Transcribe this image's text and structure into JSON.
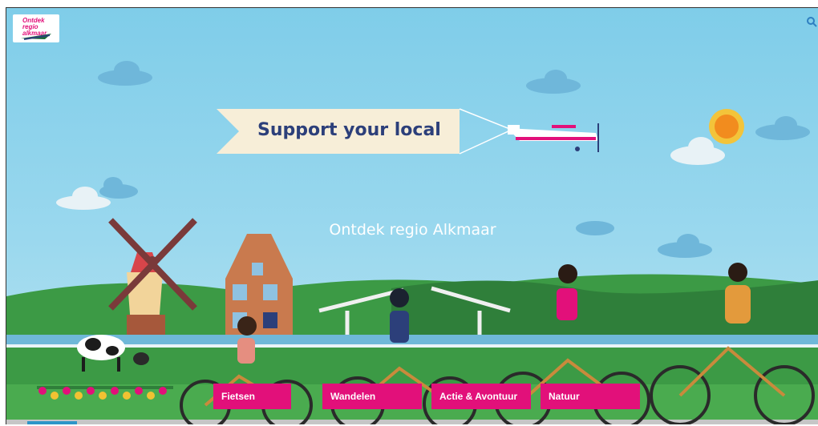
{
  "site": {
    "logo_text": "Ontdek regio alkmaar"
  },
  "hero": {
    "banner_text": "Support your local",
    "headline": "Ontdek regio Alkmaar"
  },
  "categories": [
    {
      "label": "Fietsen"
    },
    {
      "label": "Wandelen"
    },
    {
      "label": "Actie & Avontuur"
    },
    {
      "label": "Natuur"
    }
  ],
  "colors": {
    "accent": "#e2107a",
    "sky": "#8fd3ec",
    "heading": "#2c3f7a"
  },
  "icons": [
    "search-icon",
    "logo-icon"
  ]
}
